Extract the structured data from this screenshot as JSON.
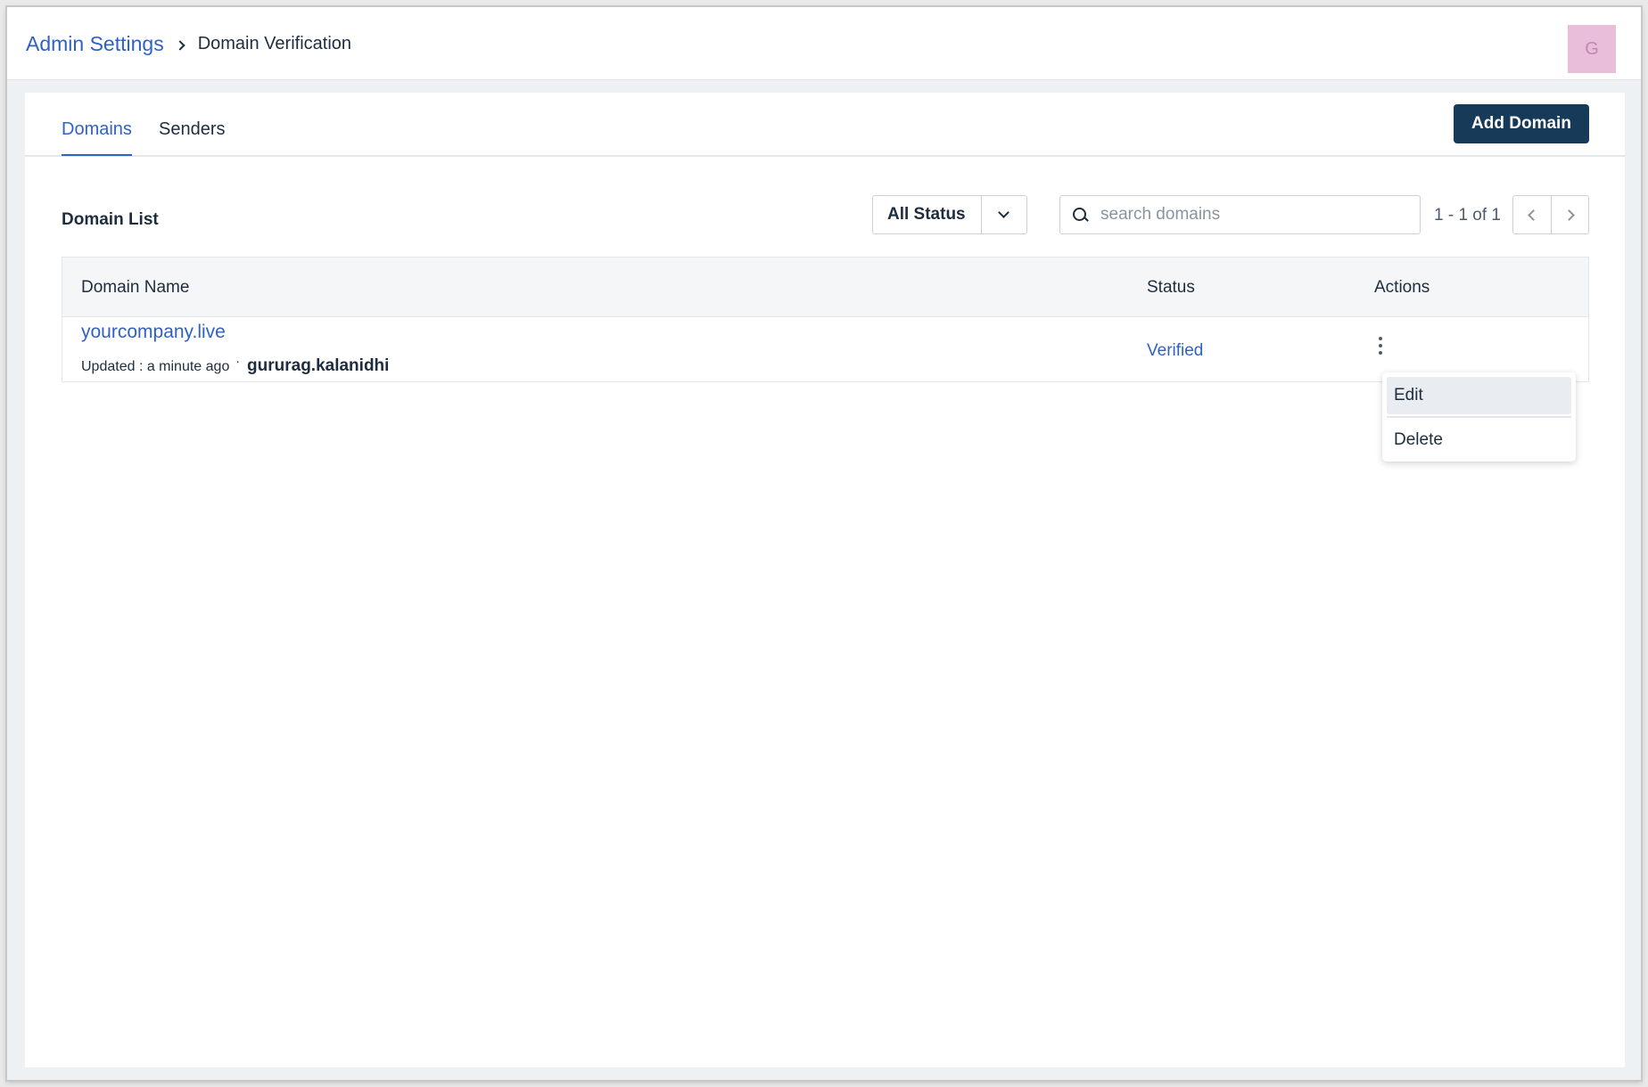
{
  "breadcrumb": {
    "parent": "Admin Settings",
    "current": "Domain Verification"
  },
  "user": {
    "avatar_initial": "G"
  },
  "tabs": [
    {
      "label": "Domains",
      "active": true
    },
    {
      "label": "Senders",
      "active": false
    }
  ],
  "toolbar": {
    "add_label": "Add Domain"
  },
  "list": {
    "title": "Domain List",
    "status_filter": "All Status",
    "search_placeholder": "search domains",
    "search_value": "",
    "pagination": "1 - 1 of 1"
  },
  "table": {
    "columns": [
      "Domain Name",
      "Status",
      "Actions"
    ],
    "rows": [
      {
        "domain": "yourcompany.live",
        "updated": "Updated : a minute ago",
        "separator": "·",
        "user": "gururag.kalanidhi",
        "status": "Verified"
      }
    ]
  },
  "menu": {
    "items": [
      "Edit",
      "Delete"
    ]
  },
  "colors": {
    "accent": "#2f62c4",
    "primary_button": "#163a57",
    "avatar_bg": "#e9bedb"
  },
  "icons": [
    "chevron-right-icon",
    "chevron-down-icon",
    "search-icon",
    "chevron-left-icon",
    "kebab-menu-icon"
  ]
}
